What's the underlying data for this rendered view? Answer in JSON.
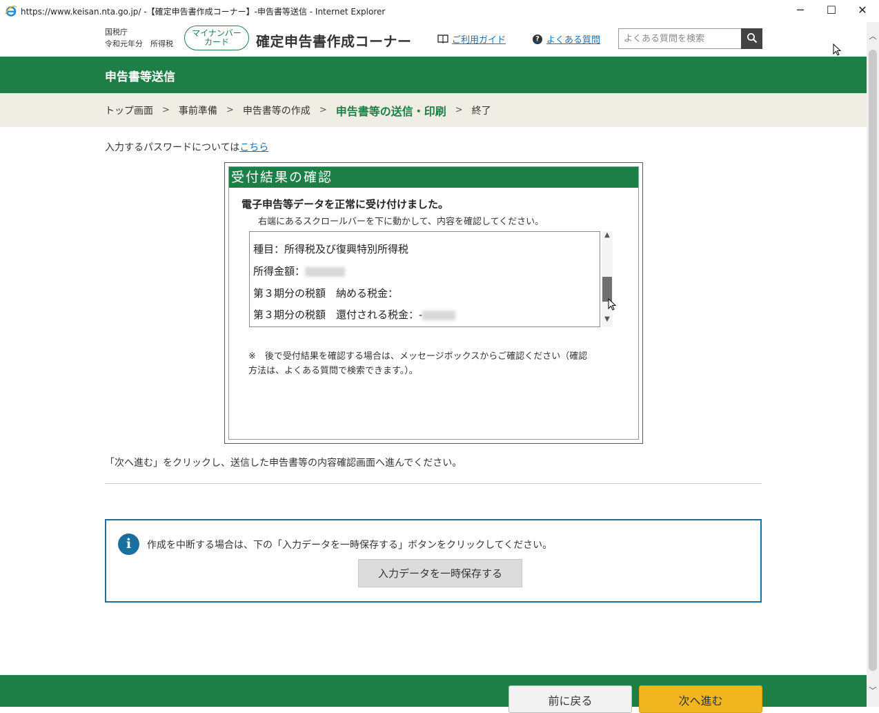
{
  "window": {
    "title": "https://www.keisan.nta.go.jp/ -【確定申告書作成コーナー】-申告書等送信 - Internet Explorer",
    "minimize": "─",
    "maximize": "☐",
    "close": "✕"
  },
  "header": {
    "agency": "国税庁",
    "year_tax": "令和元年分　所得税",
    "mynumber_line1": "マイナンバー",
    "mynumber_line2": "カード",
    "site_title": "確定申告書作成コーナー",
    "guide_label": "ご利用ガイド",
    "faq_label": "よくある質問",
    "search_placeholder": "よくある質問を検索"
  },
  "band_title": "申告書等送信",
  "breadcrumb": [
    "トップ画面",
    "事前準備",
    "申告書等の作成",
    "申告書等の送信・印刷",
    "終了"
  ],
  "password_note": {
    "text": "入力するパスワードについては",
    "link": "こちら"
  },
  "dialog": {
    "title": "受付結果の確認",
    "success": "電子申告等データを正常に受け付けました。",
    "scroll_hint": "右端にあるスクロールバーを下に動かして、内容を確認してください。",
    "lines": [
      "種目：所得税及び復興特別所得税",
      "所得金額：",
      "第３期分の税額　納める税金：",
      "第３期分の税額　還付される税金：-"
    ],
    "note": "※　後で受付結果を確認する場合は、メッセージボックスからご確認ください（確認方法は、よくある質問で検索できます。）。"
  },
  "next_instruction": "「次へ進む」をクリックし、送信した申告書等の内容確認画面へ進んでください。",
  "info_panel": {
    "text": "作成を中断する場合は、下の「入力データを一時保存する」ボタンをクリックしてください。",
    "save_button": "入力データを一時保存する"
  },
  "footer": {
    "back_button": "前に戻る",
    "next_button": "次へ進む"
  },
  "colors": {
    "brand_green": "#1e7f46",
    "info_blue": "#1b6f9e",
    "next_yellow": "#f0b51f",
    "link_blue": "#1a6fb3"
  }
}
